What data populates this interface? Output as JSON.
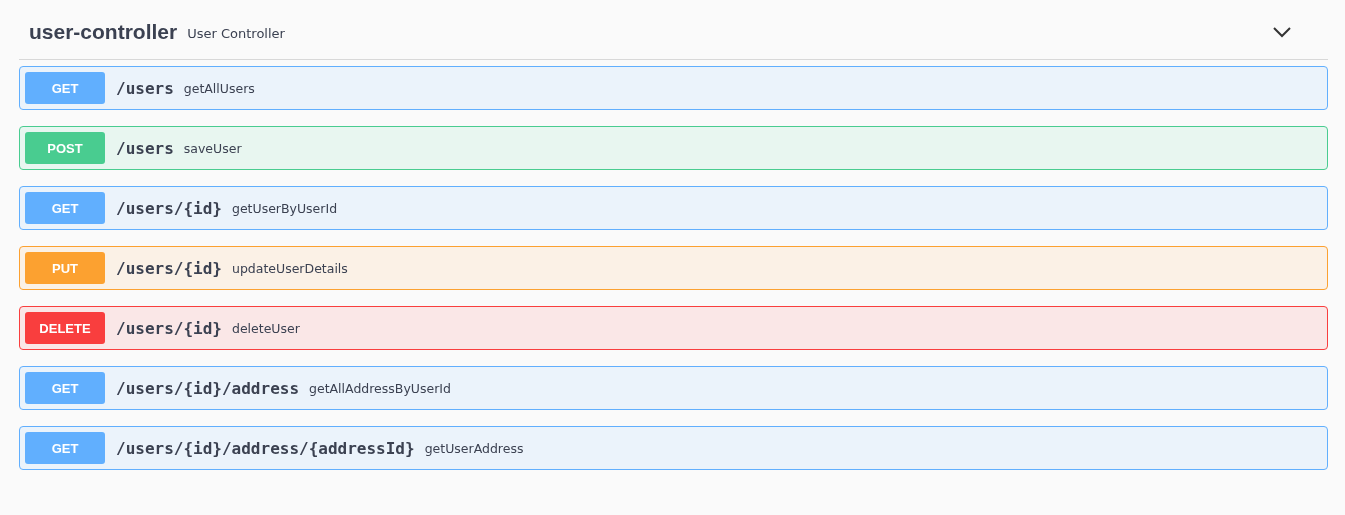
{
  "tag": {
    "name": "user-controller",
    "description": "User Controller",
    "expanded": true
  },
  "operations": [
    {
      "kind": "get",
      "method": "GET",
      "path": "/users",
      "summary": "getAllUsers"
    },
    {
      "kind": "post",
      "method": "POST",
      "path": "/users",
      "summary": "saveUser"
    },
    {
      "kind": "get",
      "method": "GET",
      "path": "/users/{id}",
      "summary": "getUserByUserId"
    },
    {
      "kind": "put",
      "method": "PUT",
      "path": "/users/{id}",
      "summary": "updateUserDetails"
    },
    {
      "kind": "delete",
      "method": "DELETE",
      "path": "/users/{id}",
      "summary": "deleteUser"
    },
    {
      "kind": "get",
      "method": "GET",
      "path": "/users/{id}/address",
      "summary": "getAllAddressByUserId"
    },
    {
      "kind": "get",
      "method": "GET",
      "path": "/users/{id}/address/{addressId}",
      "summary": "getUserAddress"
    }
  ]
}
